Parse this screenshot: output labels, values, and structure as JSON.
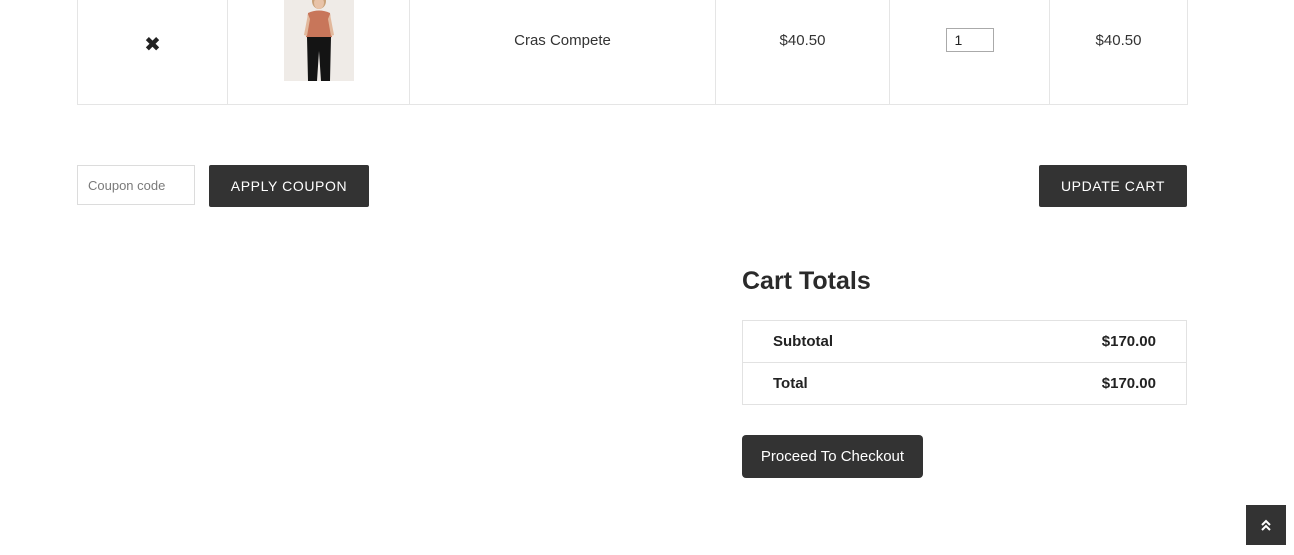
{
  "cart": {
    "items": [
      {
        "remove_symbol": "✖",
        "product_name": "Cras Compete",
        "price": "$40.50",
        "quantity": "1",
        "subtotal": "$40.50"
      }
    ]
  },
  "coupon": {
    "placeholder": "Coupon code",
    "apply_label": "APPLY COUPON"
  },
  "actions": {
    "update_cart_label": "UPDATE CART"
  },
  "totals": {
    "heading": "Cart Totals",
    "subtotal_label": "Subtotal",
    "subtotal_value": "$170.00",
    "total_label": "Total",
    "total_value": "$170.00",
    "checkout_label": "Proceed To Checkout"
  },
  "colors": {
    "button_bg": "#333333",
    "border": "#e5e5e5",
    "text": "#333333"
  },
  "icons": {
    "remove": "close-icon",
    "scroll_top": "double-chevron-up-icon"
  }
}
